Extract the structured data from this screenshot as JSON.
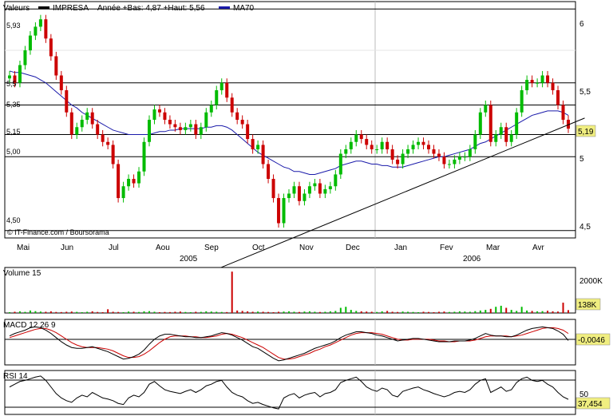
{
  "legend": {
    "valeurs_label": "Valeurs",
    "stock_name": "IMPRESA",
    "range_text": "Année +Bas: 4,87 +Haut: 5,56",
    "ma_label": "MA70"
  },
  "source": "© IT-Finance.com / Boursorama",
  "colors": {
    "up": "#00bb00",
    "down": "#cc0000",
    "ma": "#1a1aaa",
    "trend": "#000000",
    "macd": "#000000",
    "signal": "#cc0000",
    "rsi": "#000000",
    "price_tag_bg": "#f0ee80"
  },
  "chart_data": [
    {
      "type": "candlestick",
      "title": "",
      "x_months": [
        "Mai",
        "Jun",
        "Jul",
        "Aou",
        "Sep",
        "Oct",
        "Nov",
        "Dec",
        "Jan",
        "Fev",
        "Mar",
        "Avr"
      ],
      "x_years": [
        "2005",
        "2006"
      ],
      "y_right_ticks": [
        "6",
        "5,5",
        "5",
        "4,5"
      ],
      "y_left_ticks": [
        "5,93",
        "5,5",
        "5,35",
        "5,15",
        "5,00",
        "4,50"
      ],
      "last_price": "5,19",
      "ma_period": 70,
      "close": [
        5.55,
        5.5,
        5.62,
        5.72,
        5.82,
        5.88,
        5.93,
        5.8,
        5.68,
        5.55,
        5.45,
        5.3,
        5.15,
        5.2,
        5.25,
        5.3,
        5.22,
        5.15,
        5.1,
        5.08,
        4.95,
        4.72,
        4.8,
        4.85,
        4.82,
        4.9,
        5.1,
        5.25,
        5.32,
        5.3,
        5.25,
        5.22,
        5.2,
        5.18,
        5.2,
        5.22,
        5.15,
        5.2,
        5.3,
        5.35,
        5.45,
        5.5,
        5.4,
        5.3,
        5.25,
        5.22,
        5.12,
        5.05,
        5.08,
        4.95,
        4.85,
        4.72,
        4.55,
        4.72,
        4.75,
        4.8,
        4.7,
        4.75,
        4.8,
        4.82,
        4.75,
        4.78,
        4.8,
        4.88,
        5.02,
        5.05,
        5.1,
        5.15,
        5.12,
        5.08,
        5.05,
        5.05,
        5.1,
        5.05,
        4.98,
        4.95,
        5.02,
        5.05,
        5.08,
        5.1,
        5.08,
        5.05,
        5.02,
        5.0,
        4.95,
        4.95,
        4.98,
        5.0,
        5.0,
        5.05,
        5.15,
        5.3,
        5.35,
        5.1,
        5.15,
        5.2,
        5.1,
        5.15,
        5.3,
        5.45,
        5.52,
        5.5,
        5.5,
        5.55,
        5.5,
        5.45,
        5.35,
        5.25,
        5.19
      ],
      "ma70": [
        5.58,
        5.57,
        5.57,
        5.56,
        5.55,
        5.54,
        5.52,
        5.5,
        5.47,
        5.44,
        5.41,
        5.38,
        5.35,
        5.33,
        5.3,
        5.28,
        5.26,
        5.24,
        5.22,
        5.2,
        5.18,
        5.17,
        5.16,
        5.15,
        5.15,
        5.15,
        5.15,
        5.15,
        5.16,
        5.17,
        5.17,
        5.18,
        5.18,
        5.19,
        5.19,
        5.19,
        5.19,
        5.19,
        5.2,
        5.2,
        5.21,
        5.21,
        5.2,
        5.18,
        5.15,
        5.12,
        5.09,
        5.06,
        5.03,
        5.01,
        4.99,
        4.97,
        4.95,
        4.93,
        4.92,
        4.9,
        4.9,
        4.89,
        4.88,
        4.88,
        4.89,
        4.9,
        4.91,
        4.92,
        4.94,
        4.95,
        4.96,
        4.97,
        4.97,
        4.96,
        4.95,
        4.95,
        4.94,
        4.94,
        4.93,
        4.93,
        4.93,
        4.94,
        4.95,
        4.96,
        4.97,
        4.98,
        4.99,
        5.0,
        5.0,
        5.01,
        5.02,
        5.03,
        5.04,
        5.05,
        5.07,
        5.09,
        5.1,
        5.12,
        5.14,
        5.16,
        5.18,
        5.2,
        5.22,
        5.24,
        5.26,
        5.28,
        5.29,
        5.3,
        5.31,
        5.31,
        5.31,
        5.3,
        5.28
      ],
      "trendline": {
        "from": [
          36,
          4.18
        ],
        "to": [
          109,
          5.24
        ]
      },
      "ylim": [
        4.45,
        6.05
      ]
    },
    {
      "type": "bar",
      "title": "Volume 15",
      "y_ticks": [
        "2000K"
      ],
      "last_value": "138K",
      "ylim": [
        0,
        2200
      ],
      "values": [
        40,
        60,
        80,
        55,
        120,
        90,
        70,
        60,
        80,
        50,
        45,
        60,
        70,
        55,
        40,
        60,
        80,
        50,
        40,
        180,
        60,
        50,
        40,
        70,
        60,
        50,
        80,
        90,
        60,
        40,
        50,
        45,
        60,
        70,
        50,
        40,
        60,
        55,
        80,
        70,
        60,
        50,
        45,
        2000,
        120,
        100,
        80,
        60,
        70,
        60,
        50,
        40,
        60,
        70,
        80,
        60,
        50,
        70,
        80,
        60,
        50,
        60,
        80,
        100,
        250,
        300,
        150,
        100,
        80,
        70,
        60,
        50,
        80,
        100,
        60,
        50,
        70,
        60,
        50,
        40,
        60,
        50,
        40,
        60,
        70,
        50,
        60,
        80,
        70,
        60,
        90,
        120,
        150,
        200,
        300,
        350,
        250,
        150,
        100,
        300,
        120,
        100,
        80,
        90,
        110,
        80,
        70,
        500,
        138
      ]
    },
    {
      "type": "line",
      "title": "MACD 12 26 9",
      "last_value": "-0,0046",
      "ylim": [
        -0.3,
        0.25
      ],
      "macd": [
        0.05,
        0.08,
        0.1,
        0.12,
        0.15,
        0.16,
        0.15,
        0.12,
        0.08,
        0.03,
        -0.02,
        -0.06,
        -0.09,
        -0.1,
        -0.1,
        -0.09,
        -0.08,
        -0.1,
        -0.12,
        -0.14,
        -0.17,
        -0.2,
        -0.23,
        -0.22,
        -0.2,
        -0.17,
        -0.12,
        -0.05,
        0.01,
        0.05,
        0.07,
        0.07,
        0.06,
        0.05,
        0.04,
        0.04,
        0.03,
        0.03,
        0.04,
        0.05,
        0.07,
        0.09,
        0.08,
        0.06,
        0.03,
        0.0,
        -0.04,
        -0.08,
        -0.1,
        -0.14,
        -0.18,
        -0.22,
        -0.25,
        -0.24,
        -0.22,
        -0.2,
        -0.18,
        -0.16,
        -0.13,
        -0.1,
        -0.08,
        -0.06,
        -0.04,
        -0.01,
        0.03,
        0.06,
        0.08,
        0.1,
        0.1,
        0.09,
        0.08,
        0.06,
        0.05,
        0.03,
        0.01,
        -0.01,
        0.0,
        0.01,
        0.02,
        0.02,
        0.01,
        0.0,
        -0.01,
        -0.02,
        -0.02,
        -0.02,
        -0.01,
        -0.01,
        -0.01,
        0.0,
        0.02,
        0.05,
        0.08,
        0.06,
        0.05,
        0.05,
        0.04,
        0.04,
        0.06,
        0.09,
        0.12,
        0.14,
        0.15,
        0.16,
        0.15,
        0.14,
        0.11,
        0.07,
        -0.0046
      ],
      "signal": [
        0.03,
        0.05,
        0.07,
        0.09,
        0.11,
        0.13,
        0.14,
        0.14,
        0.12,
        0.09,
        0.05,
        0.01,
        -0.03,
        -0.06,
        -0.08,
        -0.09,
        -0.09,
        -0.09,
        -0.1,
        -0.11,
        -0.13,
        -0.16,
        -0.19,
        -0.21,
        -0.21,
        -0.2,
        -0.17,
        -0.13,
        -0.08,
        -0.03,
        0.01,
        0.04,
        0.05,
        0.05,
        0.05,
        0.04,
        0.04,
        0.03,
        0.03,
        0.04,
        0.05,
        0.07,
        0.08,
        0.07,
        0.05,
        0.03,
        0.0,
        -0.03,
        -0.06,
        -0.09,
        -0.13,
        -0.17,
        -0.21,
        -0.23,
        -0.23,
        -0.22,
        -0.2,
        -0.18,
        -0.16,
        -0.13,
        -0.11,
        -0.08,
        -0.06,
        -0.03,
        0.0,
        0.03,
        0.06,
        0.08,
        0.09,
        0.09,
        0.09,
        0.08,
        0.07,
        0.05,
        0.03,
        0.01,
        0.0,
        0.0,
        0.01,
        0.01,
        0.01,
        0.01,
        0.0,
        -0.01,
        -0.01,
        -0.02,
        -0.02,
        -0.01,
        -0.01,
        -0.01,
        0.0,
        0.02,
        0.04,
        0.05,
        0.05,
        0.05,
        0.05,
        0.04,
        0.05,
        0.06,
        0.08,
        0.1,
        0.12,
        0.14,
        0.15,
        0.15,
        0.14,
        0.12,
        0.08
      ]
    },
    {
      "type": "line",
      "title": "RSI 14",
      "y_ticks": [
        "50"
      ],
      "last_value": "37,454",
      "ylim": [
        10,
        90
      ],
      "values": [
        60,
        65,
        70,
        72,
        75,
        78,
        80,
        72,
        60,
        48,
        40,
        35,
        32,
        40,
        45,
        42,
        50,
        45,
        40,
        38,
        35,
        30,
        28,
        40,
        45,
        42,
        50,
        65,
        70,
        62,
        55,
        52,
        50,
        48,
        52,
        55,
        50,
        55,
        62,
        65,
        70,
        72,
        60,
        50,
        45,
        42,
        35,
        30,
        32,
        28,
        25,
        22,
        20,
        40,
        45,
        48,
        40,
        45,
        48,
        50,
        42,
        48,
        50,
        55,
        68,
        72,
        75,
        78,
        70,
        60,
        55,
        52,
        58,
        55,
        45,
        42,
        52,
        55,
        58,
        60,
        55,
        52,
        48,
        45,
        42,
        45,
        50,
        52,
        50,
        55,
        65,
        72,
        75,
        50,
        55,
        60,
        52,
        55,
        68,
        75,
        78,
        72,
        70,
        72,
        65,
        60,
        50,
        42,
        37.454
      ]
    }
  ]
}
